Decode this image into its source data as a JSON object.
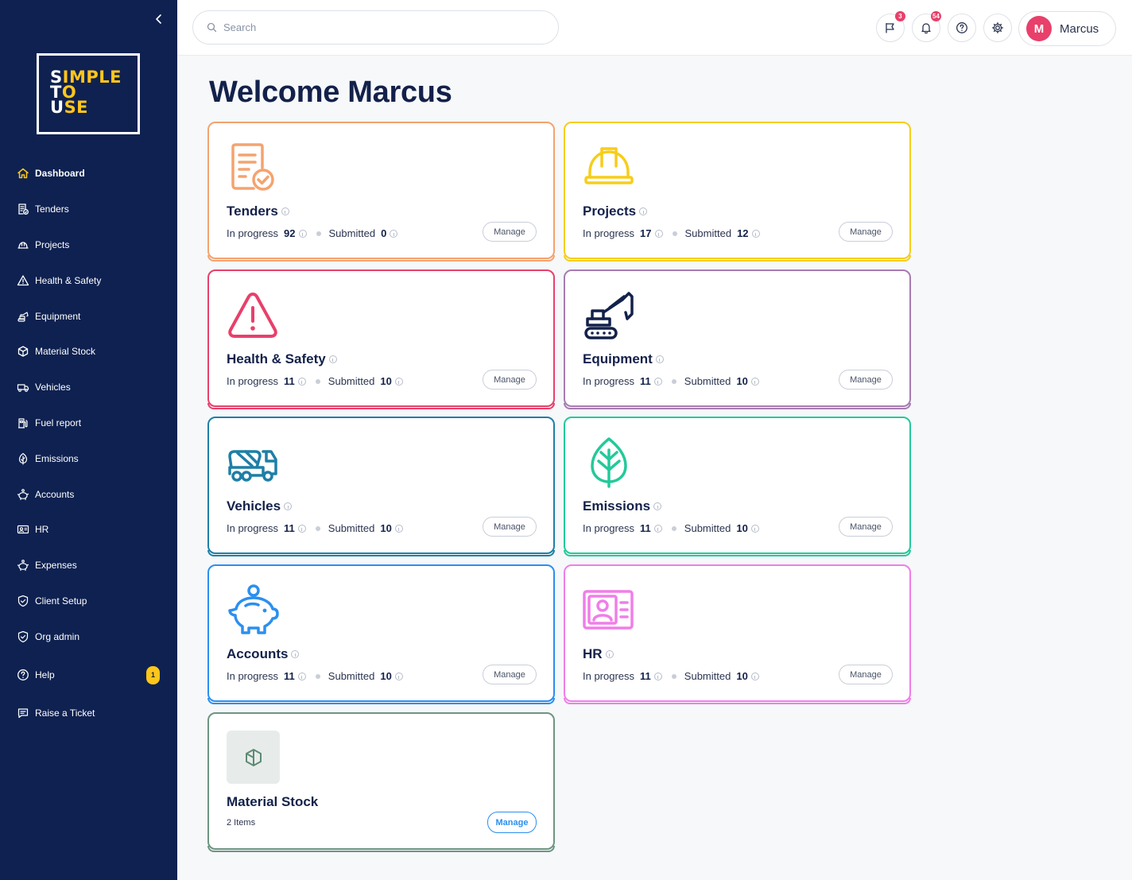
{
  "sidebar": {
    "logo": {
      "line1_white": "S",
      "line1_yellow": "IMPLE",
      "line2_white": "T",
      "line2_yellow": "O",
      "line3_white": "U",
      "line3_yellow": "SE"
    },
    "items": [
      {
        "label": "Dashboard",
        "icon": "home-icon",
        "active": true
      },
      {
        "label": "Tenders",
        "icon": "document-check-icon"
      },
      {
        "label": "Projects",
        "icon": "hard-hat-icon"
      },
      {
        "label": "Health & Safety",
        "icon": "warning-icon"
      },
      {
        "label": "Equipment",
        "icon": "excavator-icon"
      },
      {
        "label": "Material Stock",
        "icon": "box-icon"
      },
      {
        "label": "Vehicles",
        "icon": "truck-icon"
      },
      {
        "label": "Fuel report",
        "icon": "fuel-pump-icon"
      },
      {
        "label": "Emissions",
        "icon": "leaf-icon"
      },
      {
        "label": "Accounts",
        "icon": "piggy-bank-icon"
      },
      {
        "label": "HR",
        "icon": "id-card-icon"
      },
      {
        "label": "Expenses",
        "icon": "piggy-bank-icon"
      },
      {
        "label": "Client Setup",
        "icon": "shield-icon"
      },
      {
        "label": "Org admin",
        "icon": "shield-icon"
      },
      {
        "label": "Help",
        "icon": "help-icon",
        "badge": "1"
      },
      {
        "label": "Raise a Ticket",
        "icon": "message-icon"
      }
    ]
  },
  "topbar": {
    "search_placeholder": "Search",
    "announcements_badge": "3",
    "notifications_badge": "54",
    "user": {
      "initial": "M",
      "name": "Marcus"
    }
  },
  "main": {
    "title": "Welcome Marcus",
    "in_progress_label": "In progress",
    "submitted_label": "Submitted",
    "manage_label": "Manage",
    "cards": [
      {
        "title": "Tenders",
        "in_progress": "92",
        "submitted": "0",
        "color": "#f4a36f",
        "icon": "document-check-icon"
      },
      {
        "title": "Projects",
        "in_progress": "17",
        "submitted": "12",
        "color": "#f7cd1b",
        "icon": "hard-hat-icon"
      },
      {
        "title": "Health & Safety",
        "in_progress": "11",
        "submitted": "10",
        "color": "#e8406a",
        "icon": "warning-icon"
      },
      {
        "title": "Equipment",
        "in_progress": "11",
        "submitted": "10",
        "color": "#a77bb2",
        "icon": "excavator-icon"
      },
      {
        "title": "Vehicles",
        "in_progress": "11",
        "submitted": "10",
        "color": "#1e7fa6",
        "icon": "truck-icon"
      },
      {
        "title": "Emissions",
        "in_progress": "11",
        "submitted": "10",
        "color": "#24c99a",
        "icon": "leaf-icon"
      },
      {
        "title": "Accounts",
        "in_progress": "11",
        "submitted": "10",
        "color": "#2b8ff0",
        "icon": "piggy-bank-icon"
      },
      {
        "title": "HR",
        "in_progress": "11",
        "submitted": "10",
        "color": "#f07ee8",
        "icon": "id-card-icon"
      }
    ],
    "stock_card": {
      "title": "Material Stock",
      "subtitle": "2 Items",
      "manage_label": "Manage",
      "color": "#6e9582",
      "icon": "box-icon"
    }
  }
}
